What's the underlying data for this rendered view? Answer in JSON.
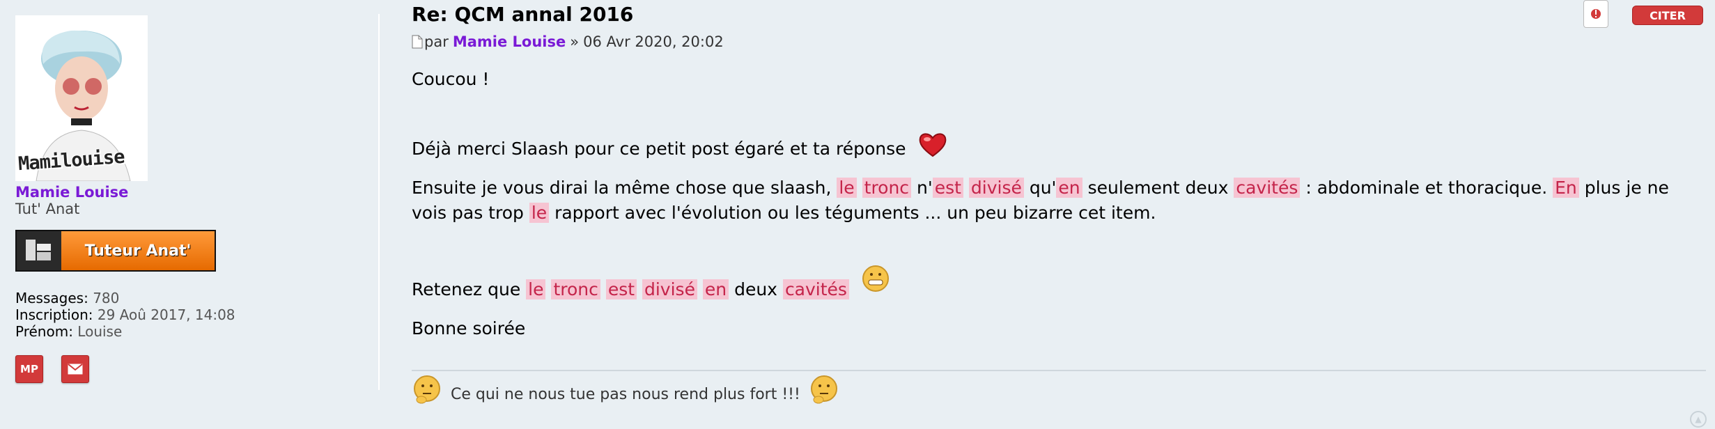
{
  "author": {
    "avatar_caption": "Mamilouise",
    "name": "Mamie Louise",
    "rank": "Tut' Anat",
    "badge_label": "Tuteur Anat'",
    "stats": [
      {
        "label": "Messages:",
        "value": "780"
      },
      {
        "label": "Inscription:",
        "value": "29 Aoû 2017, 14:08"
      },
      {
        "label": "Prénom:",
        "value": "Louise"
      }
    ],
    "pm_label": "MP"
  },
  "post": {
    "title": "Re: QCM annal 2016",
    "quote_label": "CITER",
    "meta": {
      "by": "par",
      "author": "Mamie Louise",
      "separator": "»",
      "date": "06 Avr 2020, 20:02"
    },
    "body": {
      "p1": "Coucou !",
      "p2": "Déjà merci Slaash pour ce petit post égaré et ta réponse",
      "p3": [
        {
          "t": "Ensuite je vous dirai la même chose que slaash, ",
          "hl": false
        },
        {
          "t": "le",
          "hl": true
        },
        {
          "t": " ",
          "hl": false
        },
        {
          "t": "tronc",
          "hl": true
        },
        {
          "t": " n'",
          "hl": false
        },
        {
          "t": "est",
          "hl": true
        },
        {
          "t": " ",
          "hl": false
        },
        {
          "t": "divisé",
          "hl": true
        },
        {
          "t": " qu'",
          "hl": false
        },
        {
          "t": "en",
          "hl": true
        },
        {
          "t": " seulement deux ",
          "hl": false
        },
        {
          "t": "cavités",
          "hl": true
        },
        {
          "t": " : abdominale et thoracique. ",
          "hl": false
        },
        {
          "t": "En",
          "hl": true
        },
        {
          "t": " plus je ne vois pas trop ",
          "hl": false
        },
        {
          "t": "le",
          "hl": true
        },
        {
          "t": " rapport avec l'évolution ou les téguments ... un peu bizarre cet item.",
          "hl": false
        }
      ],
      "p4": [
        {
          "t": "Retenez que ",
          "hl": false
        },
        {
          "t": "le",
          "hl": true
        },
        {
          "t": " ",
          "hl": false
        },
        {
          "t": "tronc",
          "hl": true
        },
        {
          "t": " ",
          "hl": false
        },
        {
          "t": "est",
          "hl": true
        },
        {
          "t": " ",
          "hl": false
        },
        {
          "t": "divisé",
          "hl": true
        },
        {
          "t": " ",
          "hl": false
        },
        {
          "t": "en",
          "hl": true
        },
        {
          "t": " deux ",
          "hl": false
        },
        {
          "t": "cavités",
          "hl": true
        }
      ],
      "p5": "Bonne soirée"
    },
    "signature": "Ce qui ne nous tue pas nous rend plus fort !!!"
  },
  "colors": {
    "highlight_bg": "#f6c4d2",
    "highlight_text": "#c4244a",
    "username": "#7a1ad6",
    "button_red": "#d23a3a"
  }
}
